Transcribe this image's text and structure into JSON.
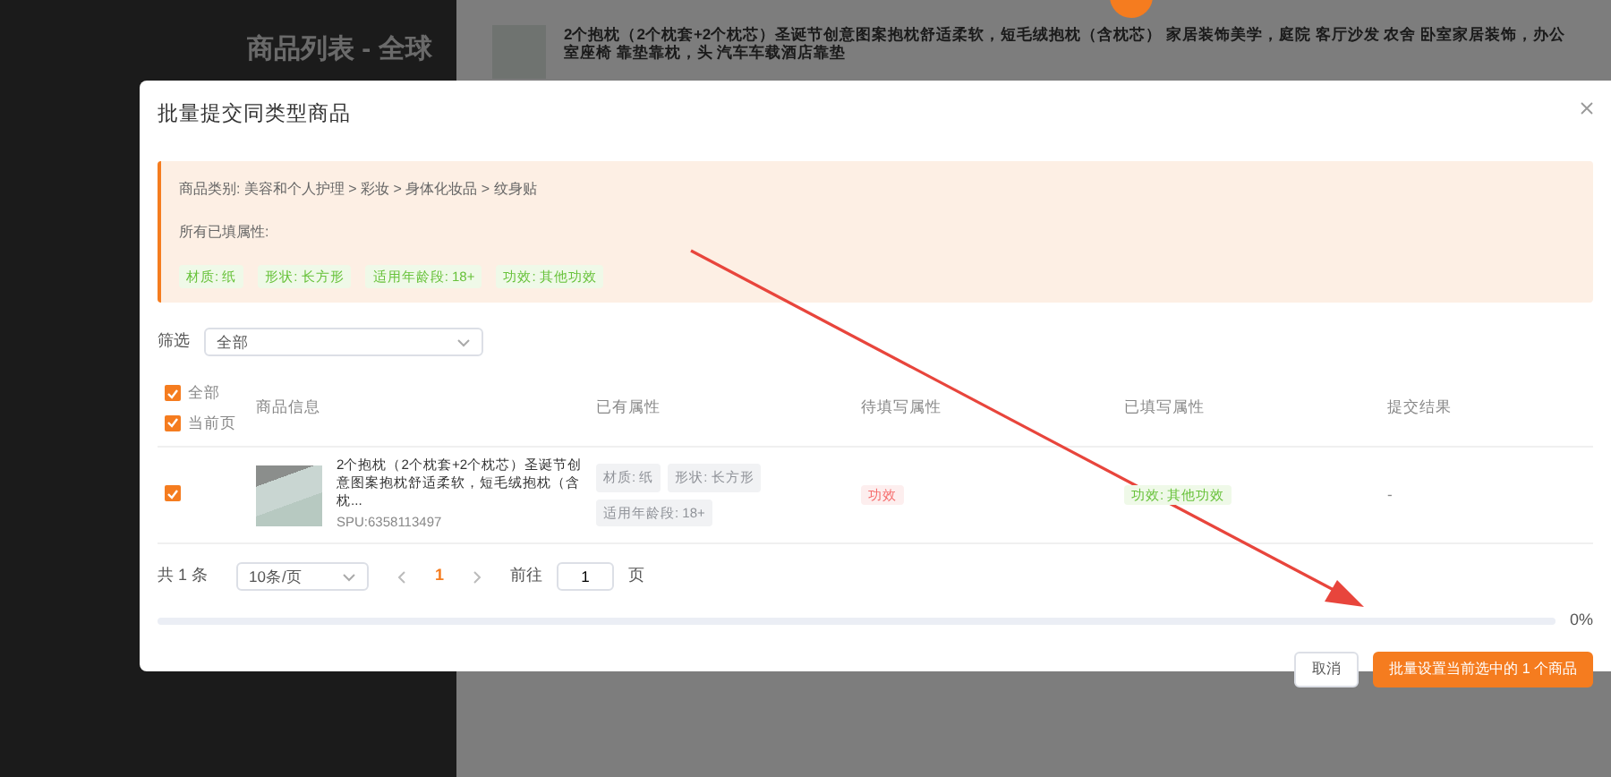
{
  "background": {
    "page_title": "商品列表 - 全球",
    "product_title": "2个抱枕（2个枕套+2个枕芯）圣诞节创意图案抱枕舒适柔软，短毛绒抱枕（含枕芯） 家居装饰美学，庭院 客厅沙发 农舍 卧室家居装饰，办公室座椅 靠垫靠枕，头 汽车车载酒店靠垫"
  },
  "dialog": {
    "title": "批量提交同类型商品",
    "category": "商品类别: 美容和个人护理 > 彩妆 > 身体化妆品 > 纹身贴",
    "filled_label": "所有已填属性:",
    "filled_attributes": [
      "材质: 纸",
      "形状: 长方形",
      "适用年龄段: 18+",
      "功效: 其他功效"
    ],
    "filter": {
      "label": "筛选",
      "value": "全部"
    },
    "table": {
      "select_all": {
        "label": "全部",
        "checked": true
      },
      "select_page": {
        "label": "当前页",
        "checked": true
      },
      "columns": [
        "商品信息",
        "已有属性",
        "待填写属性",
        "已填写属性",
        "提交结果"
      ],
      "rows": [
        {
          "checked": true,
          "title": "2个抱枕（2个枕套+2个枕芯）圣诞节创意图案抱枕舒适柔软，短毛绒抱枕（含枕...",
          "spu": "SPU:6358113497",
          "existing": [
            "材质: 纸",
            "形状: 长方形",
            "适用年龄段: 18+"
          ],
          "pending": [
            "功效"
          ],
          "filled": [
            "功效: 其他功效"
          ],
          "result": "-"
        }
      ]
    },
    "pagination": {
      "total": "共 1 条",
      "page_size": "10条/页",
      "pages": [
        {
          "label": "1",
          "selected": true
        }
      ],
      "goto_label": "前往",
      "goto_value": "1",
      "goto_suffix": "页"
    },
    "progress": {
      "level": 0,
      "reading": "0%"
    },
    "buttons": [
      {
        "label": "取消",
        "kind": "default"
      },
      {
        "label": "批量设置当前选中的 1 个商品",
        "kind": "primary"
      }
    ]
  }
}
